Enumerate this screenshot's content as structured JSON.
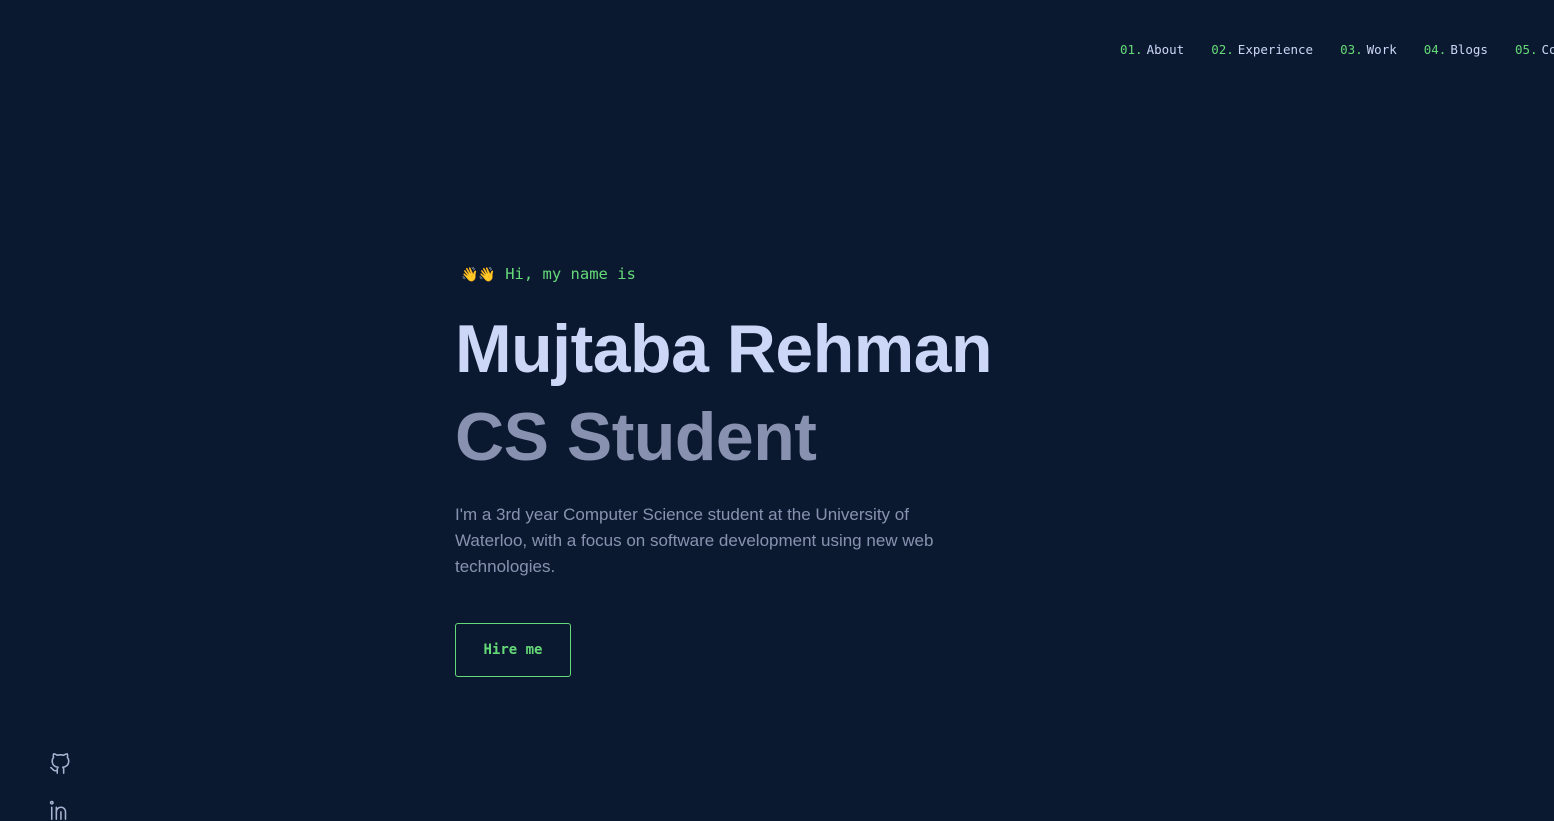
{
  "nav": {
    "items": [
      {
        "num": "01.",
        "label": "About"
      },
      {
        "num": "02.",
        "label": "Experience"
      },
      {
        "num": "03.",
        "label": "Work"
      },
      {
        "num": "04.",
        "label": "Blogs"
      },
      {
        "num": "05.",
        "label": "Contact"
      }
    ]
  },
  "hero": {
    "wave_emoji": "👋👋",
    "greeting": "Hi, my name is",
    "name": "Mujtaba Rehman",
    "role": "CS Student",
    "intro": "I'm a 3rd year Computer Science student at the University of Waterloo, with a focus on software development using new web technologies.",
    "cta_label": "Hire me"
  },
  "social": {
    "icons": [
      "github-icon",
      "linkedin-icon"
    ]
  },
  "colors": {
    "background": "#0b1930",
    "accent": "#64d977",
    "heading": "#ccd6f6",
    "muted": "#8892b0"
  }
}
